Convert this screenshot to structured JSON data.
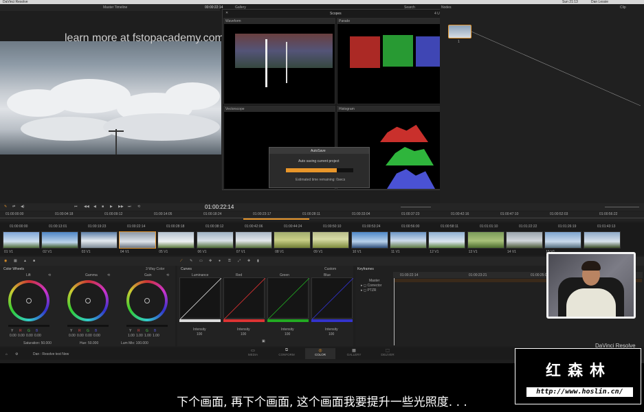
{
  "menubar": {
    "app_name": "DaVinci Resolve",
    "clock": "Sun 21:13",
    "user": "Dan Lessie"
  },
  "viewer": {
    "timeline_name": "Master Timeline",
    "timecode": "00:00:22:14"
  },
  "watermark": "learn more at fstopacademy.com",
  "gallery": {
    "label": "Gallery",
    "search_placeholder": "Search"
  },
  "scopes": {
    "title": "Scopes",
    "layout": "4 UP",
    "panels": [
      "Waveform",
      "Parade",
      "Vectorscope",
      "Histogram"
    ]
  },
  "autosave": {
    "title": "AutoSave",
    "message": "Auto saving current project",
    "progress": 0.75,
    "remaining": "Estimated time remaining: 0secs"
  },
  "nodes": {
    "label": "Nodes",
    "clip_label": "Clip",
    "node_number": "1"
  },
  "transport": {
    "timecode": "01:00:22:14"
  },
  "ruler": {
    "row1": [
      "01:00:00:00",
      "01:00:04:18",
      "01:00:09:12",
      "01:00:14:05",
      "01:00:18:24",
      "01:00:23:17",
      "01:00:28:11",
      "01:00:33:04",
      "01:00:37:23",
      "01:00:42:16",
      "01:00:47:10",
      "01:00:52:03",
      "01:00:56:22"
    ],
    "row2": [
      "01:00:00:00",
      "01:00:13:01",
      "01:00:19:23",
      "01:00:22:14",
      "01:00:28:18",
      "01:00:38:12",
      "01:00:42:06",
      "01:00:44:24",
      "01:00:50:10",
      "01:00:53:24",
      "01:00:56:00",
      "01:00:58:11",
      "01:01:01:10",
      "01:01:22:22",
      "01:01:26:19",
      "01:01:43:13"
    ]
  },
  "clips": [
    "01 V1",
    "02 V1",
    "03 V1",
    "04 V1",
    "05 V1",
    "06 V1",
    "07 V1",
    "08 V1",
    "09 V1",
    "10 V1",
    "11 V1",
    "12 V1",
    "13 V1",
    "14 V1",
    "15 V1"
  ],
  "colorwheels": {
    "title": "Color Wheels",
    "mode": "3 Way Color",
    "wheels": [
      {
        "name": "Lift",
        "values": [
          "0.00",
          "0.00",
          "0.00",
          "0.00"
        ]
      },
      {
        "name": "Gamma",
        "values": [
          "0.00",
          "0.00",
          "0.00",
          "0.00"
        ]
      },
      {
        "name": "Gain",
        "values": [
          "1.00",
          "1.00",
          "1.00",
          "1.00"
        ]
      }
    ],
    "channel_labels": [
      "Y",
      "R",
      "G",
      "B"
    ],
    "saturation": "Saturation: 50.000",
    "hue": "Hue: 50.000",
    "lum_mix": "Lum Mix: 100.000"
  },
  "curves": {
    "title": "Curves",
    "mode": "Custom",
    "channels": [
      "Luminance",
      "Red",
      "Green",
      "Blue"
    ],
    "intensity_label": "Intensity",
    "intensity_value": "100"
  },
  "keyframes": {
    "title": "Keyframes",
    "times": [
      "01:00:22:14",
      "01:00:23:21",
      "01:00:25:02"
    ],
    "rows": [
      "Master",
      "Corrector",
      "PTZR"
    ]
  },
  "status": {
    "project": "Dan : Resolve test New"
  },
  "pages": [
    "MEDIA",
    "CONFORM",
    "COLOR",
    "GALLERY",
    "DELIVER"
  ],
  "brand": "DaVinci Resolve",
  "logo": {
    "title": "红森林",
    "url": "http://www.hoslin.cn/"
  },
  "subtitle": "下个画面, 再下个画面, 这个画面我要提升一些光照度. . .",
  "colors": {
    "accent": "#e8962a",
    "node_border": "#e89a33"
  }
}
